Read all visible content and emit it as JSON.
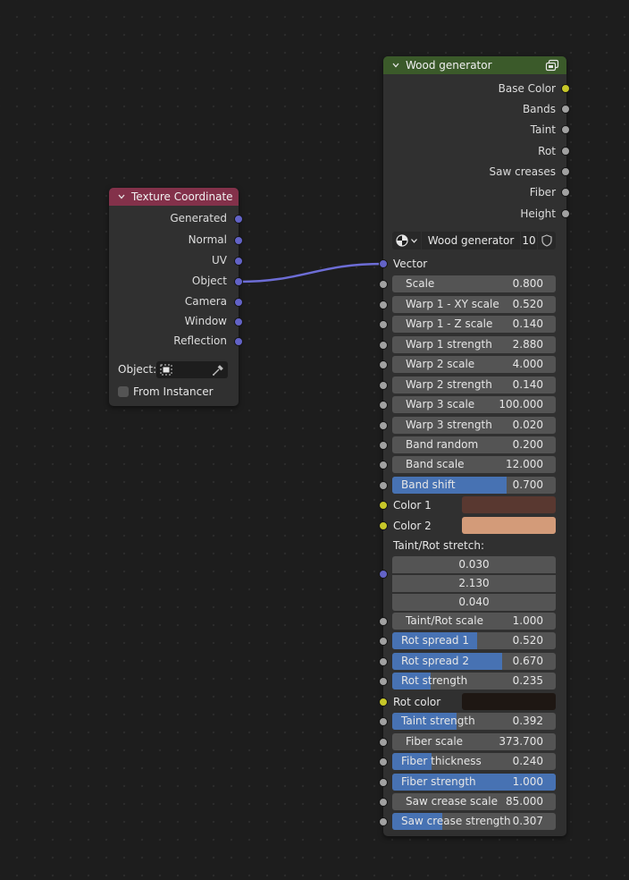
{
  "texture_node": {
    "title": "Texture Coordinate",
    "outputs": [
      "Generated",
      "Normal",
      "UV",
      "Object",
      "Camera",
      "Window",
      "Reflection"
    ],
    "object_label": "Object:",
    "from_instancer_label": "From Instancer"
  },
  "wood_node": {
    "title": "Wood generator",
    "outputs": [
      "Base Color",
      "Bands",
      "Taint",
      "Rot",
      "Saw creases",
      "Fiber",
      "Height"
    ],
    "group_name": "Wood generator",
    "user_count": "10",
    "vector_label": "Vector",
    "inputs": [
      {
        "label": "Scale",
        "value": "0.800"
      },
      {
        "label": "Warp 1 - XY scale",
        "value": "0.520"
      },
      {
        "label": "Warp 1 - Z scale",
        "value": "0.140"
      },
      {
        "label": "Warp 1 strength",
        "value": "2.880"
      },
      {
        "label": "Warp 2 scale",
        "value": "4.000"
      },
      {
        "label": "Warp 2 strength",
        "value": "0.140"
      },
      {
        "label": "Warp 3 scale",
        "value": "100.000"
      },
      {
        "label": "Warp 3 strength",
        "value": "0.020"
      },
      {
        "label": "Band random",
        "value": "0.200"
      },
      {
        "label": "Band scale",
        "value": "12.000"
      },
      {
        "label": "Band shift",
        "value": "0.700",
        "fill": 0.7
      },
      {
        "label": "Color 1",
        "color": "#593830"
      },
      {
        "label": "Color 2",
        "color": "#d39b79"
      },
      {
        "label": "Taint/Rot stretch:",
        "vector": [
          "0.030",
          "2.130",
          "0.040"
        ]
      },
      {
        "label": "Taint/Rot scale",
        "value": "1.000"
      },
      {
        "label": "Rot spread 1",
        "value": "0.520",
        "fill": 0.52
      },
      {
        "label": "Rot spread 2",
        "value": "0.670",
        "fill": 0.67
      },
      {
        "label": "Rot strength",
        "value": "0.235",
        "fill": 0.235
      },
      {
        "label": "Rot color",
        "color": "#1e1713"
      },
      {
        "label": "Taint strength",
        "value": "0.392",
        "fill": 0.392
      },
      {
        "label": "Fiber scale",
        "value": "373.700"
      },
      {
        "label": "Fiber thickness",
        "value": "0.240",
        "fill": 0.24
      },
      {
        "label": "Fiber strength",
        "value": "1.000",
        "fill": 1.0
      },
      {
        "label": "Saw crease scale",
        "value": "85.000"
      },
      {
        "label": "Saw crease strength",
        "value": "0.307",
        "fill": 0.307
      }
    ]
  },
  "colors": {
    "texture_header": "#83314a",
    "wood_header": "#3b5a2a",
    "link": "#6d6dd6",
    "slider_fill": "#4772b3"
  }
}
